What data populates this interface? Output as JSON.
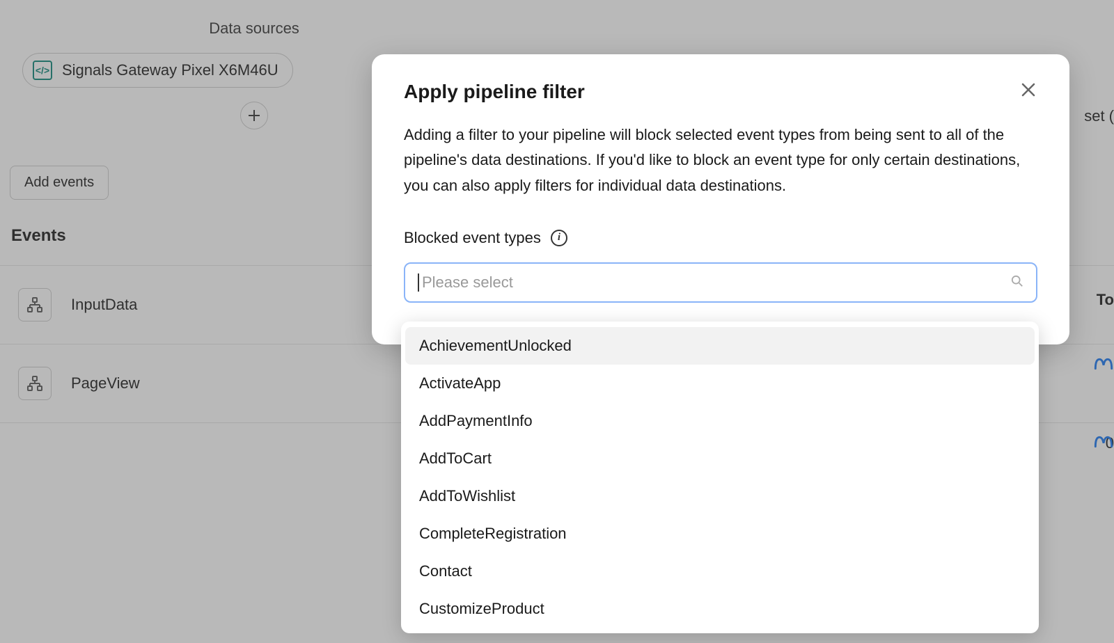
{
  "background": {
    "data_sources_header": "Data sources",
    "data_source_chip": "Signals Gateway Pixel X6M46U",
    "add_events_button": "Add events",
    "events_header": "Events",
    "event_rows": [
      {
        "name": "InputData"
      },
      {
        "name": "PageView"
      }
    ],
    "right_edge": {
      "set_text": "set (",
      "to_text": "To",
      "zero_text": "0"
    }
  },
  "modal": {
    "title": "Apply pipeline filter",
    "description": "Adding a filter to your pipeline will block selected event types from being sent to all of the pipeline's data destinations. If you'd like to block an event type for only certain destinations, you can also apply filters for individual data destinations.",
    "blocked_label": "Blocked event types",
    "select_placeholder": "Please select"
  },
  "dropdown": {
    "items": [
      "AchievementUnlocked",
      "ActivateApp",
      "AddPaymentInfo",
      "AddToCart",
      "AddToWishlist",
      "CompleteRegistration",
      "Contact",
      "CustomizeProduct"
    ]
  }
}
